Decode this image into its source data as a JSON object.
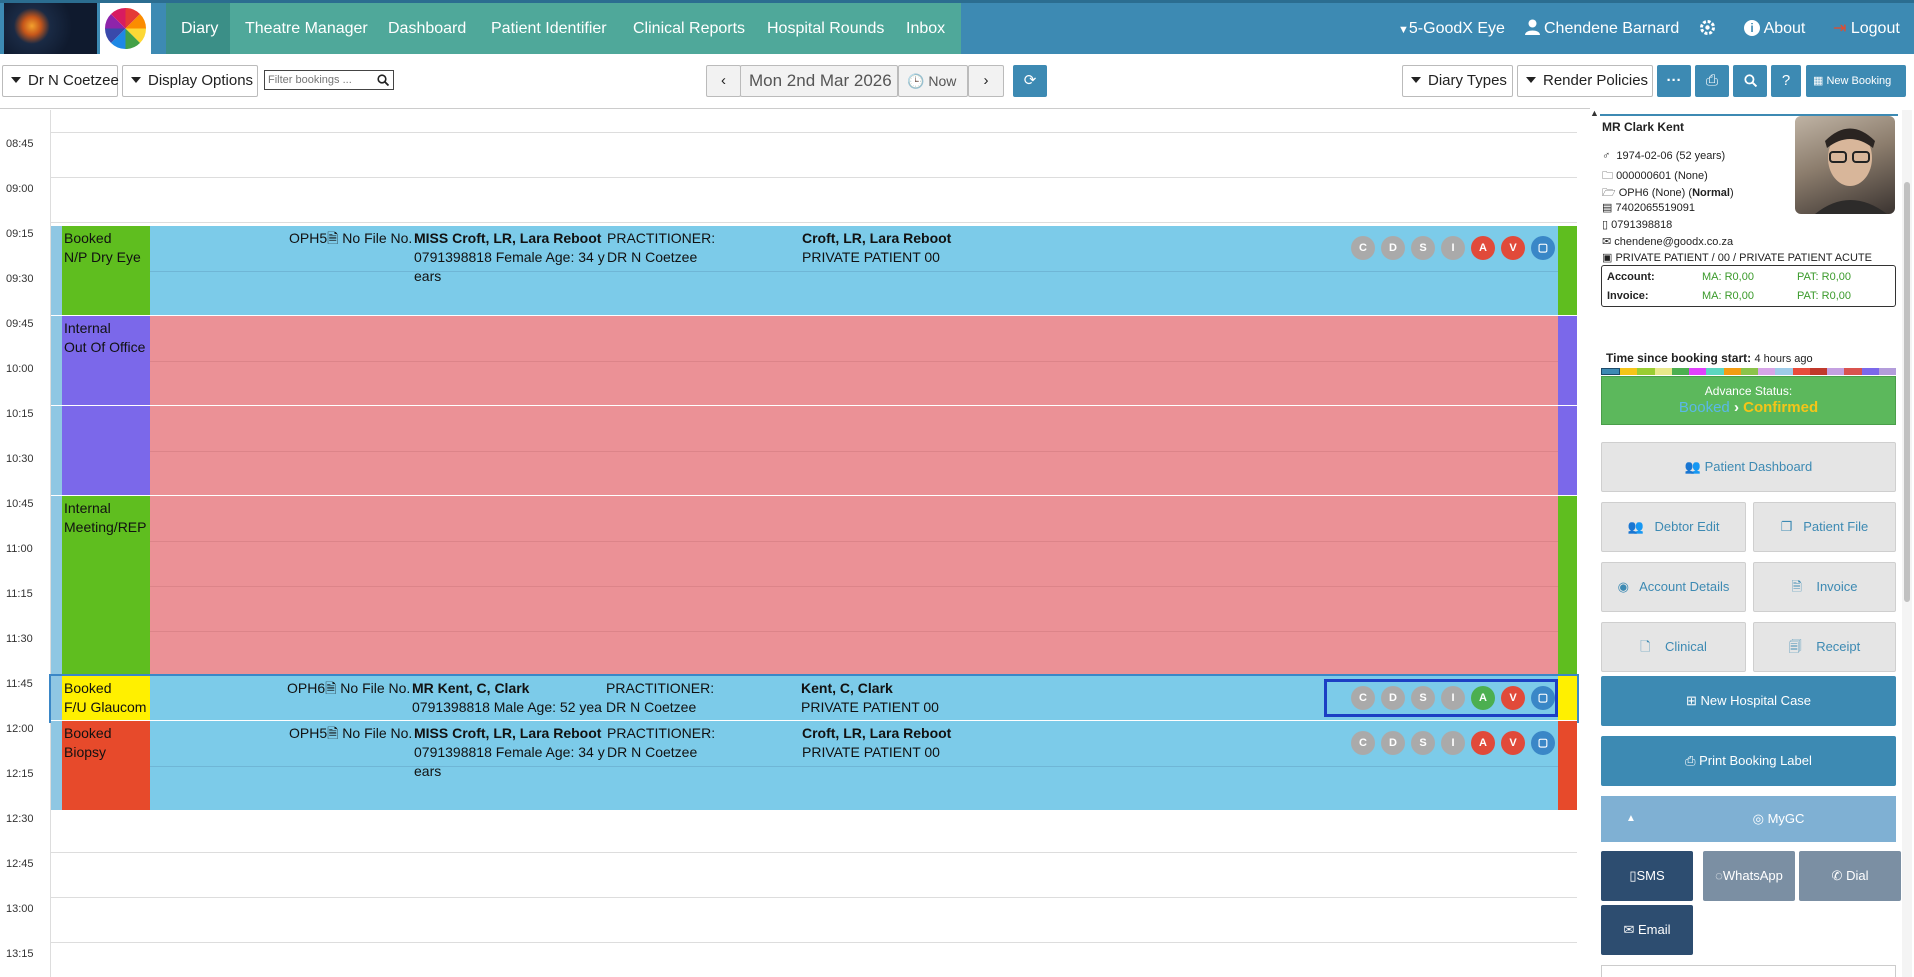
{
  "nav": {
    "items": [
      "Diary",
      "Theatre Manager",
      "Dashboard",
      "Patient Identifier",
      "Clinical Reports",
      "Hospital Rounds",
      "Inbox"
    ],
    "practice": "5-GoodX Eye",
    "user": "Chendene Barnard",
    "about": "About",
    "logout": "Logout"
  },
  "toolbar": {
    "doctor": "Dr N Coetzee",
    "display_options": "Display Options",
    "filter_placeholder": "Filter bookings ...",
    "date": "Mon 2nd Mar 2026",
    "now": "Now",
    "diary_types": "Diary Types",
    "render_policies": "Render Policies",
    "more": "···",
    "new_booking": "New Booking"
  },
  "times": [
    "08:45",
    "09:00",
    "09:15",
    "09:30",
    "09:45",
    "10:00",
    "10:15",
    "10:30",
    "10:45",
    "11:00",
    "11:15",
    "11:30",
    "11:45",
    "12:00",
    "12:15",
    "12:30",
    "12:45",
    "13:00",
    "13:15"
  ],
  "status_icons": [
    "C",
    "D",
    "S",
    "I",
    "A",
    "V"
  ],
  "appointments": [
    {
      "status1": "Booked",
      "status2": "N/P Dry Eye",
      "code": "OPH5",
      "file": "No File No.",
      "name": "MISS Croft, LR, Lara Reboot",
      "details": "0791398818 Female Age: 34 y",
      "extra": "ears",
      "practitioner_label": "PRACTITIONER:",
      "practitioner": "DR N Coetzee",
      "patient": "Croft, LR, Lara Reboot",
      "scheme": "PRIVATE PATIENT 00"
    },
    {
      "status1": "Internal",
      "status2": "Out Of Office"
    },
    {
      "status1": "Internal",
      "status2": "Meeting/REP"
    },
    {
      "status1": "Booked",
      "status2": "F/U Glaucom",
      "code": "OPH6",
      "file": "No File No.",
      "name": "MR Kent, C, Clark",
      "details": "0791398818 Male Age: 52 yea",
      "practitioner_label": "PRACTITIONER:",
      "practitioner": "DR N Coetzee",
      "patient": "Kent, C, Clark",
      "scheme": "PRIVATE PATIENT 00"
    },
    {
      "status1": "Booked",
      "status2": "Biopsy",
      "code": "OPH5",
      "file": "No File No.",
      "name": "MISS Croft, LR, Lara Reboot",
      "details": "0791398818 Female Age: 34 y",
      "extra": "ears",
      "practitioner_label": "PRACTITIONER:",
      "practitioner": "DR N Coetzee",
      "patient": "Croft, LR, Lara Reboot",
      "scheme": "PRIVATE PATIENT 00"
    }
  ],
  "patient": {
    "name": "MR Clark Kent",
    "dob": "1974-02-06 (52 years)",
    "file": "000000601 (None)",
    "code": "OPH6 (None) (",
    "code_bold": "Normal",
    "code_end": ")",
    "id_no": "7402065519091",
    "phone": "0791398818",
    "email": "chendene@goodx.co.za",
    "scheme": "PRIVATE PATIENT / 00 / PRIVATE PATIENT ACUTE",
    "account_label": "Account:",
    "account_ma": "MA: R0,00",
    "account_pat": "PAT: R0,00",
    "invoice_label": "Invoice:",
    "invoice_ma": "MA: R0,00",
    "invoice_pat": "PAT: R0,00",
    "time_label": "Time since booking start:",
    "time_value": "4 hours ago",
    "advance_label": "Advance Status:",
    "from_status": "Booked",
    "to_status": "Confirmed"
  },
  "panel_buttons": {
    "patient_dashboard": "Patient Dashboard",
    "debtor_edit": "Debtor Edit",
    "patient_file": "Patient File",
    "account_details": "Account Details",
    "invoice": "Invoice",
    "clinical": "Clinical",
    "receipt": "Receipt",
    "new_hospital_case": "New Hospital Case",
    "print_booking_label": "Print Booking Label",
    "mygc": "MyGC",
    "sms": "SMS",
    "whatsapp": "WhatsApp",
    "dial": "Dial",
    "email": "Email"
  },
  "colors": {
    "nav": "#3d8ab3",
    "booking": "#7ccbe9",
    "internal": "#eb9196",
    "dry_eye": "#5fbe1f",
    "out_of_office": "#7b68ea",
    "glaucoma": "#fff000",
    "biopsy": "#e74a2b",
    "advance": "#5cb85c"
  }
}
